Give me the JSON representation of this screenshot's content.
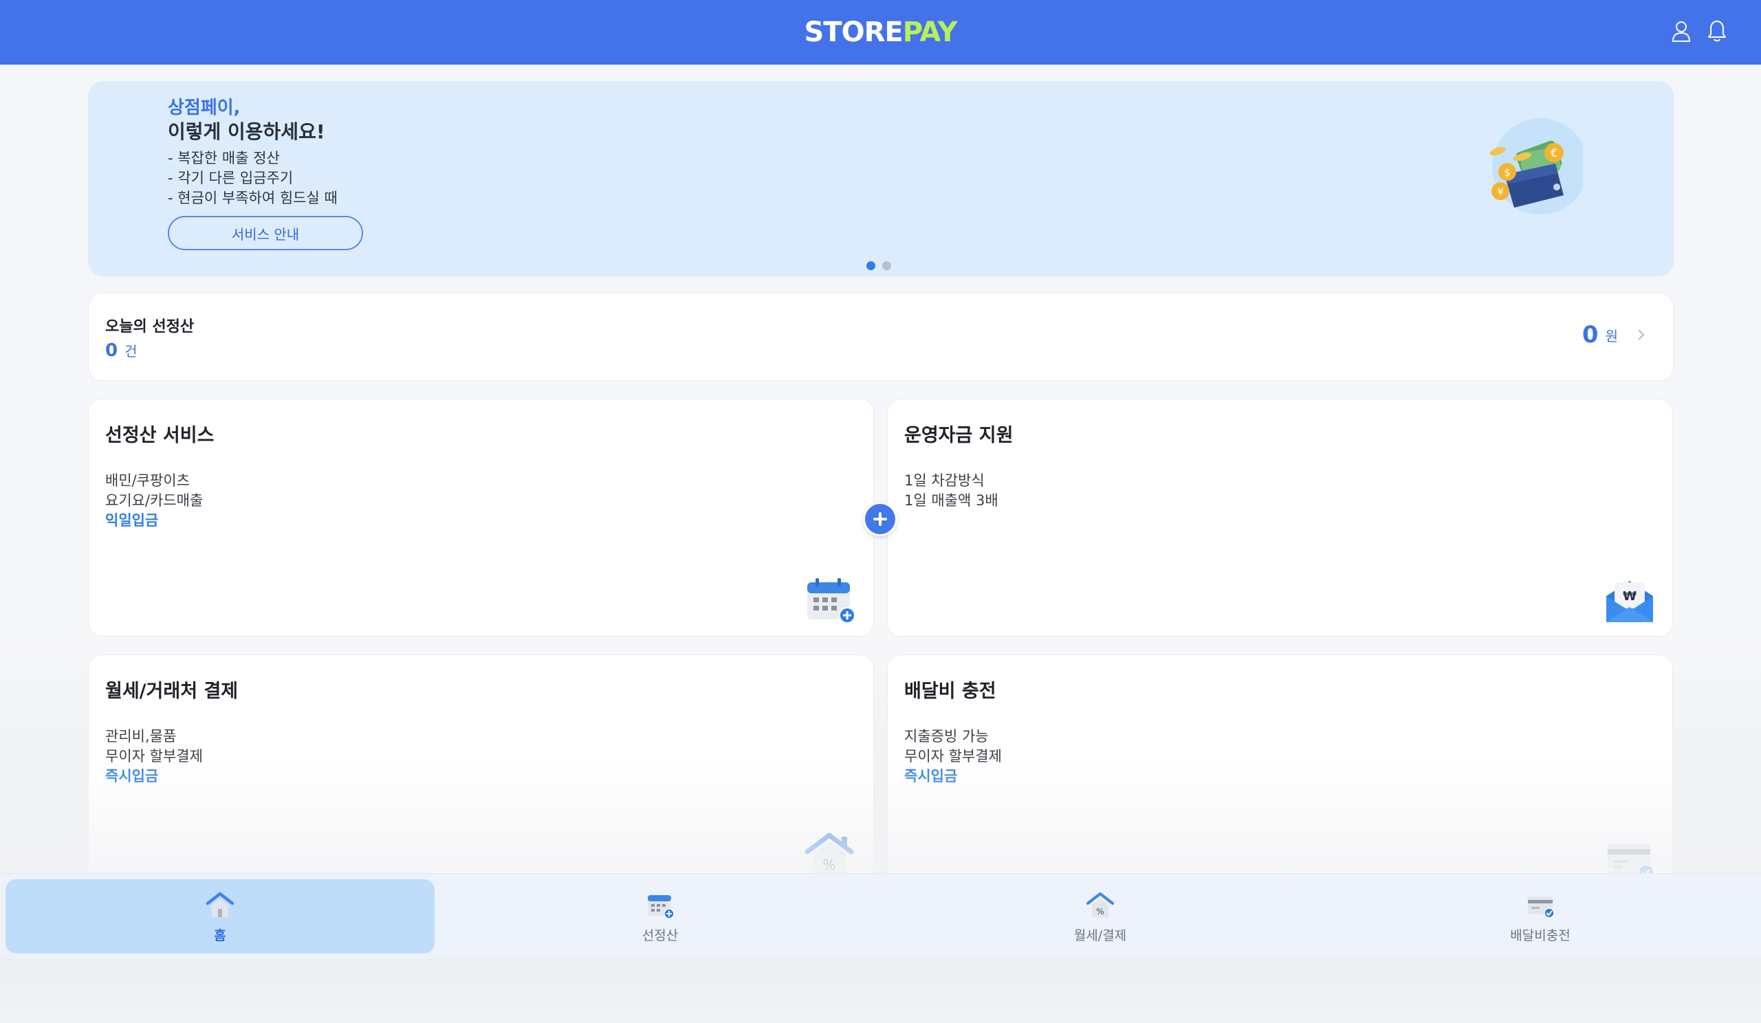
{
  "header": {
    "logo_store": "STORE",
    "logo_pay": "PAY",
    "icons": [
      "user-icon",
      "bell-icon"
    ]
  },
  "banner": {
    "title_line1": "상점페이,",
    "title_line2": "이렇게 이용하세요!",
    "lines": [
      "- 복잡한 매출 정산",
      "- 각기 다른 입금주기",
      "- 현금이 부족하여 힘드실 때"
    ],
    "button_label": "서비스 안내",
    "page_count": 2,
    "active_page": 1
  },
  "today": {
    "title": "오늘의 선정산",
    "count": "0",
    "count_unit": "건",
    "amount": "0",
    "amount_unit": "원"
  },
  "cards": [
    {
      "title": "선정산 서비스",
      "lines": [
        "배민/쿠팡이츠",
        "요기요/카드매출"
      ],
      "accent": "익일입금",
      "icon": "calendar-plus-icon"
    },
    {
      "title": "운영자금 지원",
      "lines": [
        "1일 차감방식",
        "1일 매출액 3배"
      ],
      "accent": "",
      "icon": "won-envelope-icon"
    },
    {
      "title": "월세/거래처 결제",
      "lines": [
        "관리비,물품",
        "무이자 할부결제"
      ],
      "accent": "즉시입금",
      "icon": "house-percent-icon"
    },
    {
      "title": "배달비 충전",
      "lines": [
        "지출증빙 가능",
        "무이자 할부결제"
      ],
      "accent": "즉시입금",
      "icon": "card-check-icon"
    }
  ],
  "tabbar": {
    "tabs": [
      {
        "label": "홈",
        "icon": "home-icon",
        "active": true
      },
      {
        "label": "선정산",
        "icon": "calendar-plus-icon",
        "active": false
      },
      {
        "label": "월세/결제",
        "icon": "house-percent-icon",
        "active": false
      },
      {
        "label": "배달비충전",
        "icon": "card-check-icon",
        "active": false
      }
    ]
  },
  "colors": {
    "header": "#4472ea",
    "logo_pay": "#b6f05a",
    "accent": "#2f80e0",
    "banner_bg": "#dcecfd",
    "active_tab_bg": "#bfdcfb"
  }
}
